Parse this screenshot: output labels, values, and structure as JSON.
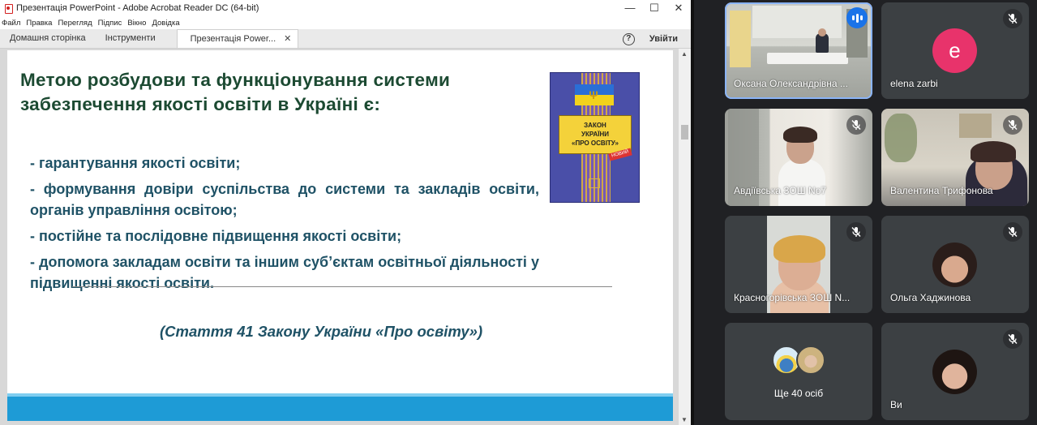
{
  "acrobat": {
    "window_title": "Презентація PowerPoint - Adobe Acrobat Reader DC (64-bit)",
    "window_controls": {
      "minimize": "—",
      "maximize": "☐",
      "close": "✕"
    },
    "menu": [
      "Файл",
      "Правка",
      "Перегляд",
      "Підпис",
      "Вікно",
      "Довідка"
    ],
    "tabs": {
      "home": "Домашня сторінка",
      "tools": "Інструменти",
      "doc": "Презентація Power...",
      "close": "✕"
    },
    "help_icon": "?",
    "sign_in": "Увійти",
    "scroll": {
      "up": "▲",
      "down": "▼"
    }
  },
  "slide": {
    "title_line1": "Метою розбудови та функціонування системи",
    "title_line2": "забезпечення якості освіти в Україні є:",
    "bullets": [
      "- гарантування якості освіти;",
      "- формування довіри суспільства до системи та закладів освіти, органів управління освітою;",
      "- постійне та послідовне підвищення якості освіти;",
      "- допомога закладам освіти та іншим суб’єктам освітньої діяльності у підвищенні якості освіти."
    ],
    "citation": "(Стаття 41 Закону України «Про освіту»)",
    "book": {
      "line1": "ЗАКОН",
      "line2": "УКРАЇНИ",
      "line3": "«ПРО ОСВІТУ»",
      "trident": "Ψ",
      "stamp": "НОВИЙ"
    }
  },
  "meet": {
    "participants": [
      {
        "name": "Оксана Олександрівна ...",
        "status": "speaking"
      },
      {
        "name": "elena zarbi",
        "initial": "e",
        "status": "muted"
      },
      {
        "name": "Авдіївська ЗОШ No7",
        "status": "muted"
      },
      {
        "name": "Валентина Трифонова",
        "status": "muted"
      },
      {
        "name": "Красногорівська ЗОШ N...",
        "status": "muted"
      },
      {
        "name": "Ольга Хаджинова",
        "status": "muted"
      },
      {
        "name": "Ще 40 осіб"
      },
      {
        "name": "Ви",
        "status": "muted"
      }
    ],
    "colors": {
      "tile": "#3c4043",
      "avatar_e": "#e8336b",
      "speaking": "#1a73e8",
      "panel": "#202124"
    }
  }
}
